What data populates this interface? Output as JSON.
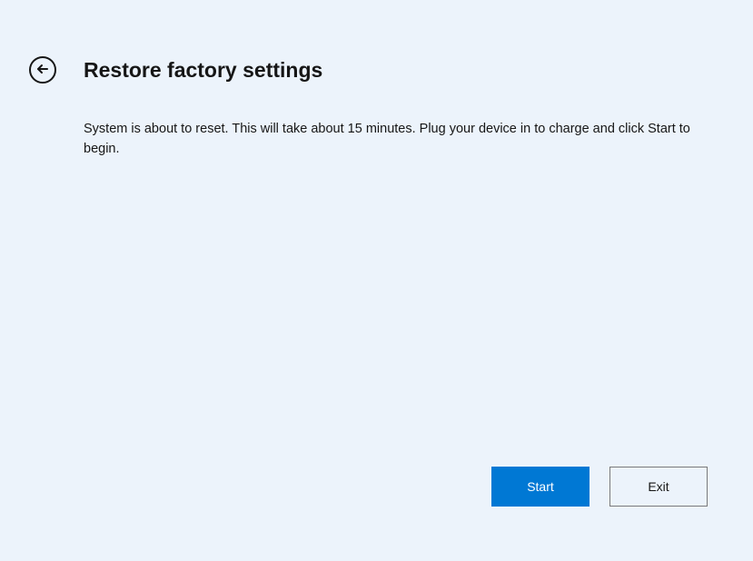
{
  "header": {
    "title": "Restore factory settings"
  },
  "body": {
    "description": "System is about to reset. This will take about 15 minutes. Plug your device in to charge and click Start to begin."
  },
  "actions": {
    "primary_label": "Start",
    "secondary_label": "Exit"
  },
  "colors": {
    "background": "#ecf3fb",
    "primary_button": "#0078d4",
    "text": "#161616"
  }
}
